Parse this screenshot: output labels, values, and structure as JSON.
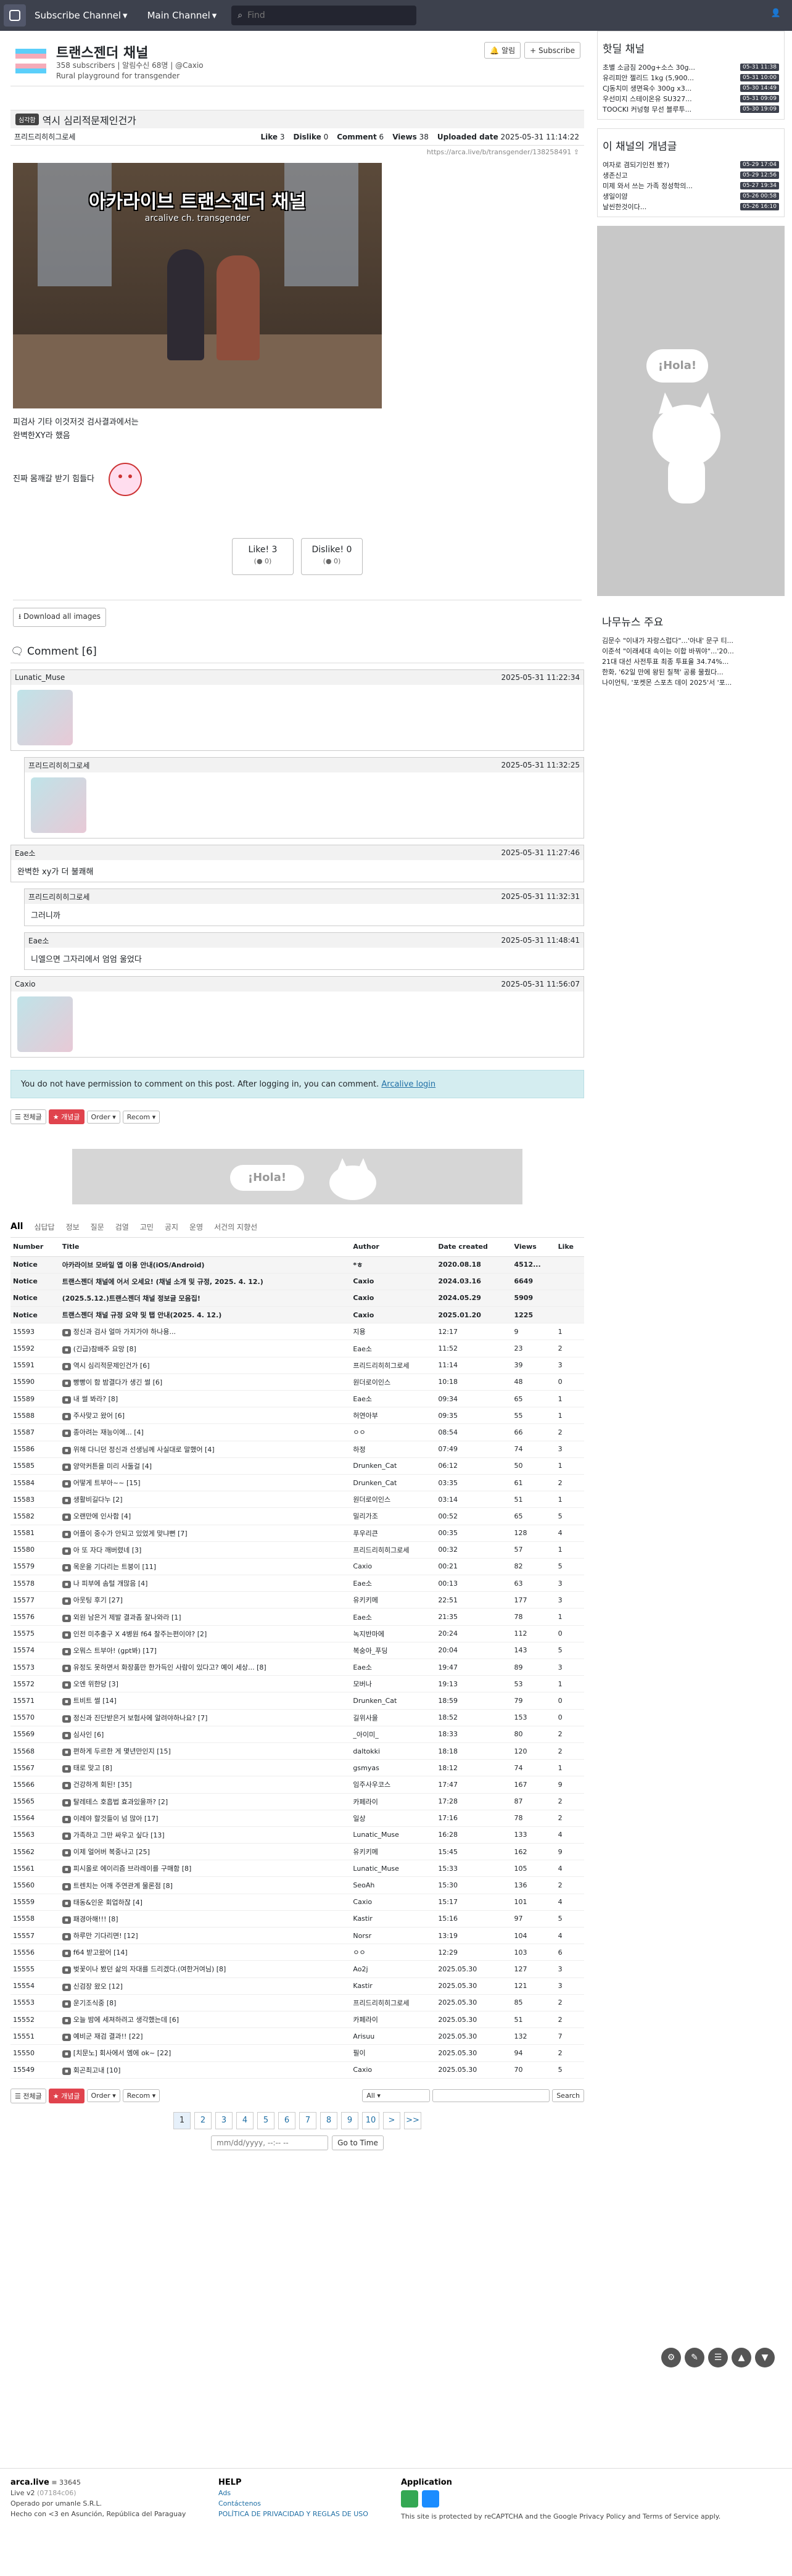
{
  "nav": {
    "channel_menu": "Subscribe Channel",
    "main_menu": "Main Channel",
    "search_placeholder": "Find"
  },
  "channel": {
    "name": "트랜스젠더 채널",
    "subs": "358 subscribers",
    "notify": "알림수신 68명",
    "owner": "@Caxio",
    "desc": "Rural playground for transgender",
    "alarm_btn": "알림",
    "subscribe_btn": "+ Subscribe"
  },
  "article": {
    "category": "심각함",
    "title": "역시 심리적문제인건가",
    "author": "프리드리히히그로세",
    "like_label": "Like",
    "like": "3",
    "dislike_label": "Dislike",
    "dislike": "0",
    "comment_label": "Comment",
    "comment": "6",
    "views_label": "Views",
    "views": "38",
    "uploaded_label": "Uploaded date",
    "uploaded": "2025-05-31 11:14:22",
    "url": "https://arca.live/b/transgender/138258491",
    "image_title": "아카라이브 트랜스젠더 채널",
    "image_sub": "arcalive ch. transgender",
    "line1": "피검사 기타 이것저것 검사결과에서는",
    "line2": "완벽한XY라 했음",
    "line3": "진짜 몸깨갈 받기 힘들다",
    "like_btn": "Like!",
    "like_btn_count": "3",
    "like_btn_sub": "(● 0)",
    "dislike_btn": "Dislike!",
    "dislike_btn_count": "0",
    "dislike_btn_sub": "(● 0)",
    "download": "Download all images"
  },
  "comments": {
    "heading": "Comment [6]",
    "items": [
      {
        "author": "Lunatic_Muse",
        "date": "2025-05-31 11:22:34",
        "text": "",
        "sticker": true,
        "reply": false
      },
      {
        "author": "프리드리히히그로세",
        "date": "2025-05-31 11:32:25",
        "text": "",
        "sticker": true,
        "reply": true
      },
      {
        "author": "Eae소",
        "date": "2025-05-31 11:27:46",
        "text": "완벽한 xy가 더 불쾌해",
        "sticker": false,
        "reply": false
      },
      {
        "author": "프리드리히히그로세",
        "date": "2025-05-31 11:32:31",
        "text": "그러니까",
        "sticker": false,
        "reply": true
      },
      {
        "author": "Eae소",
        "date": "2025-05-31 11:48:41",
        "text": "니엘으면 그자리에서 엄엄 울었다",
        "sticker": false,
        "reply": true
      },
      {
        "author": "Caxio",
        "date": "2025-05-31 11:56:07",
        "text": "",
        "sticker": true,
        "reply": false
      }
    ]
  },
  "notice": {
    "text": "You do not have permission to comment on this post. After logging in, you can comment.",
    "link": "Arcalive login"
  },
  "toolbar": {
    "all": "전체글",
    "best": "개념글",
    "order": "Order",
    "recom": "Recom"
  },
  "ad": {
    "bubble": "¡Hola!"
  },
  "cats": [
    "All",
    "심답답",
    "정보",
    "질문",
    "검열",
    "고민",
    "공지",
    "운영",
    "서건의 지향선"
  ],
  "table": {
    "headers": [
      "Number",
      "Title",
      "Author",
      "Date created",
      "Views",
      "Like"
    ],
    "rows": [
      [
        "Notice",
        "아카라이브 모바일 앱 이용 안내(iOS/Android)",
        "*ㅎ",
        "2020.08.18",
        "4512...",
        ""
      ],
      [
        "Notice",
        "트랜스젠더 채널에 어서 오세요! (채널 소개 및 규정, 2025. 4. 12.)",
        "Caxio",
        "2024.03.16",
        "6649",
        ""
      ],
      [
        "Notice",
        "(2025.5.12.)트랜스젠더 채널 정보글 모음집!",
        "Caxio",
        "2024.05.29",
        "5909",
        ""
      ],
      [
        "Notice",
        "트랜스젠더 채널 규정 요약 및 탭 안내(2025. 4. 12.)",
        "Caxio",
        "2025.01.20",
        "1225",
        ""
      ],
      [
        "15593",
        "정신과 검사 얼마 가지가야 하나용...",
        "지용",
        "12:17",
        "9",
        "1"
      ],
      [
        "15592",
        "(긴급)참배주 요망 [8]",
        "Eae소",
        "11:52",
        "23",
        "2"
      ],
      [
        "15591",
        "역시 심리적문제인건가 [6]",
        "프리드리히히그로세",
        "11:14",
        "39",
        "3"
      ],
      [
        "15590",
        "빵빵이 함 밤결다가 생긴 썰 [6]",
        "원더로이인스",
        "10:18",
        "48",
        "0"
      ],
      [
        "15589",
        "내 썰 봐라? [8]",
        "Eae소",
        "09:34",
        "65",
        "1"
      ],
      [
        "15588",
        "주사맞고 왔어 [6]",
        "허연아부",
        "09:35",
        "55",
        "1"
      ],
      [
        "15587",
        "종아려는 재능이에... [4]",
        "ㅇㅇ",
        "08:54",
        "66",
        "2"
      ],
      [
        "15586",
        "위해 다니던 정신과 선생님께 사실대로 말했어 [4]",
        "하정",
        "07:49",
        "74",
        "3"
      ],
      [
        "15585",
        "양악커튼을 미리 사둘걸 [4]",
        "Drunken_Cat",
        "06:12",
        "50",
        "1"
      ],
      [
        "15584",
        "어떻게 트부아~~ [15]",
        "Drunken_Cat",
        "03:35",
        "61",
        "2"
      ],
      [
        "15583",
        "생활비길다누 [2]",
        "원더로이인스",
        "03:14",
        "51",
        "1"
      ],
      [
        "15582",
        "오랜만에 인사함 [4]",
        "밀리가조",
        "00:52",
        "65",
        "5"
      ],
      [
        "15581",
        "어플이 중수가 안되고 있었게 맞냐뻔 [7]",
        "푸우리큰",
        "00:35",
        "128",
        "4"
      ],
      [
        "15580",
        "아 또 자다 깨버렸네 [3]",
        "프리드리히히그로세",
        "00:32",
        "57",
        "1"
      ],
      [
        "15579",
        "목운을 기다리는 트붕이 [11]",
        "Caxio",
        "00:21",
        "82",
        "5"
      ],
      [
        "15578",
        "나 피부에 솜털 개많음 [4]",
        "Eae소",
        "00:13",
        "63",
        "3"
      ],
      [
        "15577",
        "아웃팅 후기 [27]",
        "유키키메",
        "22:51",
        "177",
        "3"
      ],
      [
        "15576",
        "외원 남은거 제발 결과좀 잘나와라 [1]",
        "Eae소",
        "21:35",
        "78",
        "1"
      ],
      [
        "15575",
        "인전 미추출구 X 4병원 f64 찰주는편이야? [2]",
        "녹지반마에",
        "20:24",
        "112",
        "0"
      ],
      [
        "15574",
        "오뭐스 트부아! (gpt봐) [17]",
        "복숭아_푸딩",
        "20:04",
        "143",
        "5"
      ],
      [
        "15573",
        "유정도 못하면서 화장품만 한가득인 사람이 있다고? 예이 세상... [8]",
        "Eae소",
        "19:47",
        "89",
        "3"
      ],
      [
        "15572",
        "오엔 위한당 [3]",
        "모버나",
        "19:13",
        "53",
        "1"
      ],
      [
        "15571",
        "트비트 썰 [14]",
        "Drunken_Cat",
        "18:59",
        "79",
        "0"
      ],
      [
        "15570",
        "정신과 진단받은거 보험사에 알려야하나요? [7]",
        "길위사을",
        "18:52",
        "153",
        "0"
      ],
      [
        "15569",
        "심사인 [6]",
        "_아이미_",
        "18:33",
        "80",
        "2"
      ],
      [
        "15568",
        "편하게 두르한 게 몇년만인지 [15]",
        "daltokki",
        "18:18",
        "120",
        "2"
      ],
      [
        "15567",
        "태로 맞고 [8]",
        "gsmyas",
        "18:12",
        "74",
        "1"
      ],
      [
        "15566",
        "건강하게 회된! [35]",
        "임주사우코스",
        "17:47",
        "167",
        "9"
      ],
      [
        "15565",
        "탈레테스 호흡법 효과있을까? [2]",
        "카페라이",
        "17:28",
        "87",
        "2"
      ],
      [
        "15564",
        "이레야 할것들이 넘 많아 [17]",
        "일상",
        "17:16",
        "78",
        "2"
      ],
      [
        "15563",
        "가족하고 그만 싸우고 싶다 [13]",
        "Lunatic_Muse",
        "16:28",
        "133",
        "4"
      ],
      [
        "15562",
        "이제 얼어버 복중나고 [25]",
        "유키키메",
        "15:45",
        "162",
        "9"
      ],
      [
        "15561",
        "피시올로 에이리즘 브라레이를 구매함 [8]",
        "Lunatic_Muse",
        "15:33",
        "105",
        "4"
      ],
      [
        "15560",
        "트렌치는 어깨 주연관계 물론점 [8]",
        "SeoAh",
        "15:30",
        "136",
        "2"
      ],
      [
        "15559",
        "태동&인운 회업하잖 [4]",
        "Caxio",
        "15:17",
        "101",
        "4"
      ],
      [
        "15558",
        "패경아해!!! [8]",
        "Kastir",
        "15:16",
        "97",
        "5"
      ],
      [
        "15557",
        "하루만 기다리면! [12]",
        "Norsr",
        "13:19",
        "104",
        "4"
      ],
      [
        "15556",
        "f64 받고왔어 [14]",
        "ㅇㅇ",
        "12:29",
        "103",
        "6"
      ],
      [
        "15555",
        "벚꽃이나 봤던 삶의 자대를 드리겠다.(여한거여님) [8]",
        "Ao2j",
        "2025.05.30",
        "127",
        "3"
      ],
      [
        "15554",
        "신검장 왔오 [12]",
        "Kastir",
        "2025.05.30",
        "121",
        "3"
      ],
      [
        "15553",
        "운기조식중 [8]",
        "프리드리히히그로세",
        "2025.05.30",
        "85",
        "2"
      ],
      [
        "15552",
        "오늘 밤에 세져하려고 생각했는데 [6]",
        "카페라이",
        "2025.05.30",
        "51",
        "2"
      ],
      [
        "15551",
        "예비군 재검 결과!! [22]",
        "Arisuu",
        "2025.05.30",
        "132",
        "7"
      ],
      [
        "15550",
        "[치문노] 회사에서 엠에 ok~ [22]",
        "필이",
        "2025.05.30",
        "94",
        "2"
      ],
      [
        "15549",
        "회곤최고내 [10]",
        "Caxio",
        "2025.05.30",
        "70",
        "5"
      ]
    ]
  },
  "pager": {
    "pages": [
      "1",
      "2",
      "3",
      "4",
      "5",
      "6",
      "7",
      "8",
      "9",
      "10"
    ],
    "next": ">",
    "last": ">>",
    "select": "All",
    "search_btn": "Search",
    "date_placeholder": "mm/dd/yyyy, --:-- --",
    "goto": "Go to Time"
  },
  "sidebar": {
    "hot_title": "핫딜 채널",
    "hot": [
      [
        "초별 소금짐 200g+소스 30g...",
        "05-31 11:38"
      ],
      [
        "유리피안 젤리드 1kg (5,900...",
        "05-31 10:00"
      ],
      [
        "CJ동치미 생면육수 300g x3...",
        "05-30 14:49"
      ],
      [
        "우선미지 스테이온유 SU327...",
        "05-31 09:09"
      ],
      [
        "TOOCKI 커넝형 무선 블루투...",
        "05-30 19:09"
      ]
    ],
    "best_title": "이 채널의 개념글",
    "best": [
      [
        "여자로 겸되기인전 봤?)",
        "05-29 17:04"
      ],
      [
        "생존신고",
        "05-29 12:56"
      ],
      [
        "미제 와서 쓰는 가족 정성학의...",
        "05-27 19:34"
      ],
      [
        "생일이얌",
        "05-26 00:58"
      ],
      [
        "날씬한것이다...",
        "05-26 16:10"
      ]
    ],
    "ad_bubble": "¡Hola!",
    "news_title": "나무뉴스 주요",
    "news": [
      "김문수 \"이내가 자랑스럽다\"...'아내' 문구 티...",
      "이준석 \"이래세대 속이는 이합 바꿔야\"...'20...",
      "21대 대선 사전투표 최종 투표율 34.74%...",
      "한화, '62일 만에 왕된 칠책' 공룡 물줬다...",
      "나이언틱, '포켓몬 스포츠 데이 2025'서 '포..."
    ]
  },
  "footer": {
    "brand": "arca.live",
    "visitors": "≡ 33645",
    "version": "Live v2",
    "version_num": "(07184c06)",
    "operado": "Operado por umanle S.R.L.",
    "hecho": "Hecho con <3 en Asunción, República del Paraguay",
    "help": "HELP",
    "ads": "Ads",
    "contact": "Contáctenos",
    "policy": "POLÍTICA DE PRIVACIDAD Y REGLAS DE USO",
    "app": "Application",
    "recaptcha": "This site is protected by reCAPTCHA and the Google Privacy Policy and Terms of Service apply."
  }
}
